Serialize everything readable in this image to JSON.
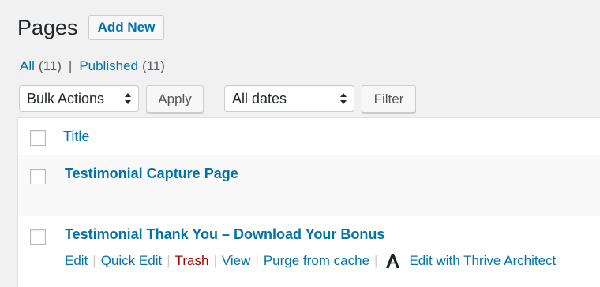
{
  "header": {
    "title": "Pages",
    "add_new_label": "Add New"
  },
  "views": {
    "all_label": "All",
    "all_count": "(11)",
    "separator": "|",
    "published_label": "Published",
    "published_count": "(11)"
  },
  "tablenav": {
    "bulk_actions_value": "Bulk Actions",
    "apply_label": "Apply",
    "dates_value": "All dates",
    "filter_label": "Filter"
  },
  "table": {
    "columns": [
      "Title"
    ],
    "rows": [
      {
        "title": "Testimonial Capture Page",
        "actions": []
      },
      {
        "title": "Testimonial Thank You – Download Your Bonus",
        "actions": [
          "Edit",
          "Quick Edit",
          "Trash",
          "View",
          "Purge from cache",
          "Edit with Thrive Architect"
        ]
      }
    ]
  },
  "colors": {
    "link": "#0073aa",
    "trash": "#aa0000",
    "background": "#f1f1f1"
  },
  "icons": {
    "thrive": "thrive-architect-icon"
  }
}
